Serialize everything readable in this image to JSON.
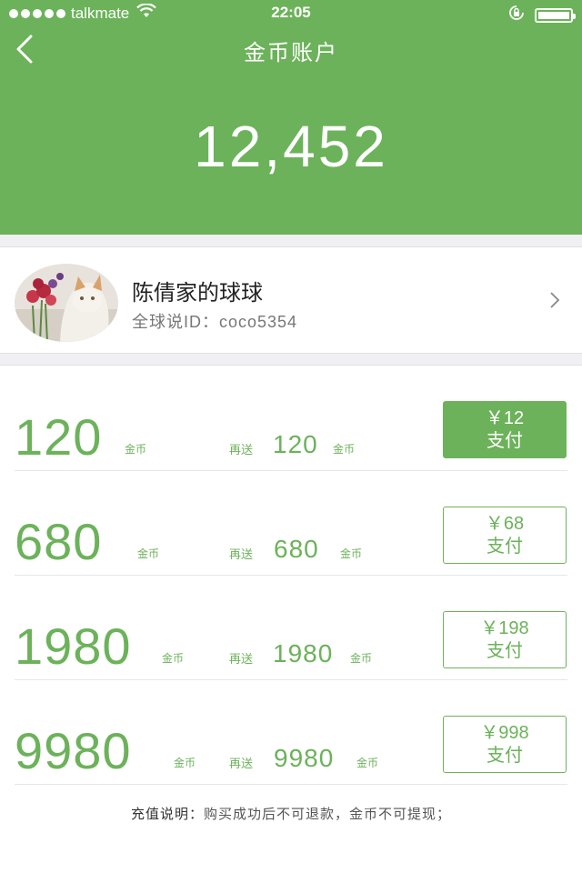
{
  "status_bar": {
    "carrier": "talkmate",
    "time": "22:05",
    "icons": [
      "signal-dots-icon",
      "wifi-icon",
      "rotation-lock-icon",
      "battery-icon"
    ]
  },
  "header": {
    "title": "金币账户",
    "balance": "12,452",
    "background_color": "#6cb25a"
  },
  "profile": {
    "name": "陈倩家的球球",
    "id_label": "全球说ID：",
    "id_value": "coco5354"
  },
  "packages": [
    {
      "coins": "120",
      "unit": "金币",
      "bonus_label": "再送",
      "bonus": "120",
      "bonus_unit": "金币",
      "price": "￥12",
      "pay_label": "支付",
      "selected": true
    },
    {
      "coins": "680",
      "unit": "金币",
      "bonus_label": "再送",
      "bonus": "680",
      "bonus_unit": "金币",
      "price": "￥68",
      "pay_label": "支付",
      "selected": false
    },
    {
      "coins": "1980",
      "unit": "金币",
      "bonus_label": "再送",
      "bonus": "1980",
      "bonus_unit": "金币",
      "price": "￥198",
      "pay_label": "支付",
      "selected": false
    },
    {
      "coins": "9980",
      "unit": "金币",
      "bonus_label": "再送",
      "bonus": "9980",
      "bonus_unit": "金币",
      "price": "￥998",
      "pay_label": "支付",
      "selected": false
    }
  ],
  "footer": {
    "label": "充值说明：",
    "text": "购买成功后不可退款，金币不可提现；"
  }
}
